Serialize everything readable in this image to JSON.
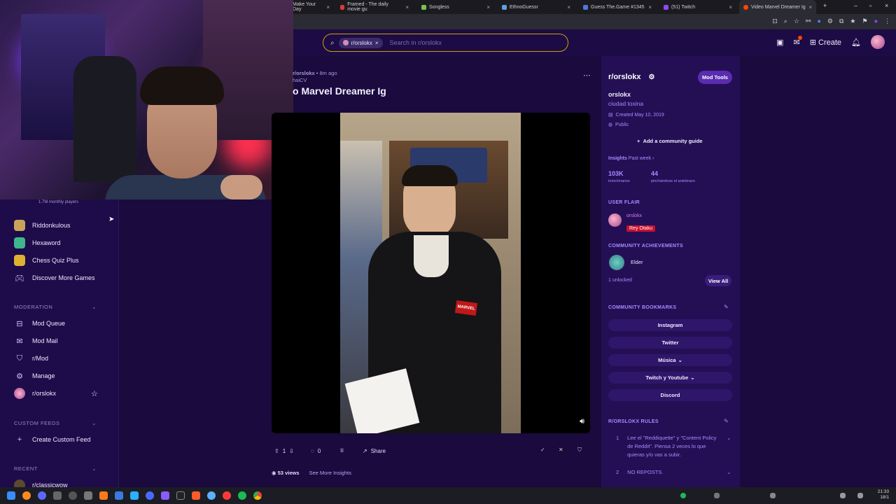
{
  "browser": {
    "tabs": [
      {
        "title": "Make Your Day",
        "color": "#e0a53a",
        "active": false
      },
      {
        "title": "Framed - The daily movie gu",
        "color": "#d93a3a",
        "active": false
      },
      {
        "title": "Songless",
        "color": "#7ec04b",
        "active": false
      },
      {
        "title": "EthnoGuessr",
        "color": "#5aa0e0",
        "active": false
      },
      {
        "title": "Guess The.Game #1345",
        "color": "#4a7ad8",
        "active": false
      },
      {
        "title": "(51) Twitch",
        "color": "#9146ff",
        "active": false
      },
      {
        "title": "Video Marvel Dreamer Ig",
        "color": "#ff4500",
        "active": true
      }
    ]
  },
  "header": {
    "search_chip": "r/orslokx",
    "search_placeholder": "Search in r/orslokx",
    "create_label": "Create"
  },
  "sidebar": {
    "players_caption": "1.7M monthly players",
    "games": [
      {
        "label": "Riddonkulous",
        "color": "#c9a35a"
      },
      {
        "label": "Hexaword",
        "color": "#3fb68c"
      },
      {
        "label": "Chess Quiz Plus",
        "color": "#e0b030"
      }
    ],
    "discover_label": "Discover More Games",
    "moderation_title": "MODERATION",
    "moderation_items": [
      "Mod Queue",
      "Mod Mail",
      "r/Mod",
      "Manage",
      "r/orslokx"
    ],
    "custom_feeds_title": "CUSTOM FEEDS",
    "create_feed_label": "Create Custom Feed",
    "recent_title": "RECENT",
    "recent_item": "r/classicwow"
  },
  "post": {
    "subreddit": "r/orslokx",
    "age": "8m ago",
    "author": "haiCV",
    "title": "o Marvel Dreamer Ig",
    "upvotes": "1",
    "comments": "0",
    "share_label": "Share",
    "views": "53 views",
    "insights_label": "See More Insights"
  },
  "community": {
    "name": "r/orslokx",
    "mod_tools_label": "Mod Tools",
    "display_name": "orslokx",
    "description": "ciudad toxina",
    "created": "Created May 10, 2019",
    "visibility": "Public",
    "guide_label": "Add a community guide",
    "insights_title": "Insights",
    "insights_range": "Past week",
    "stat1_value": "103K",
    "stat1_label": "toxicómanos",
    "stat2_value": "44",
    "stat2_label": "pinchándose el antebrazo",
    "user_flair_title": "USER FLAIR",
    "flair_user": "orslokx",
    "flair_text": "Rey Otaku",
    "achievements_title": "COMMUNITY ACHIEVEMENTS",
    "achievement": "Elder",
    "unlocked": "1 unlocked",
    "view_all_label": "View All",
    "bookmarks_title": "COMMUNITY BOOKMARKS",
    "bookmarks": [
      "Instagram",
      "Twitter",
      "Música",
      "Twitch y Youtube",
      "Discord"
    ],
    "rules_title": "R/ORSLOKX RULES",
    "rules": [
      {
        "n": "1",
        "text": "Lee el \"Reddiquette\" y \"Content Policy de Reddit\". Piensa 2 veces lo que quieras y/o vas a subir."
      },
      {
        "n": "2",
        "text": "NO REPOSTS."
      }
    ]
  },
  "taskbar": {
    "time": "21:33",
    "date": "18/1"
  }
}
